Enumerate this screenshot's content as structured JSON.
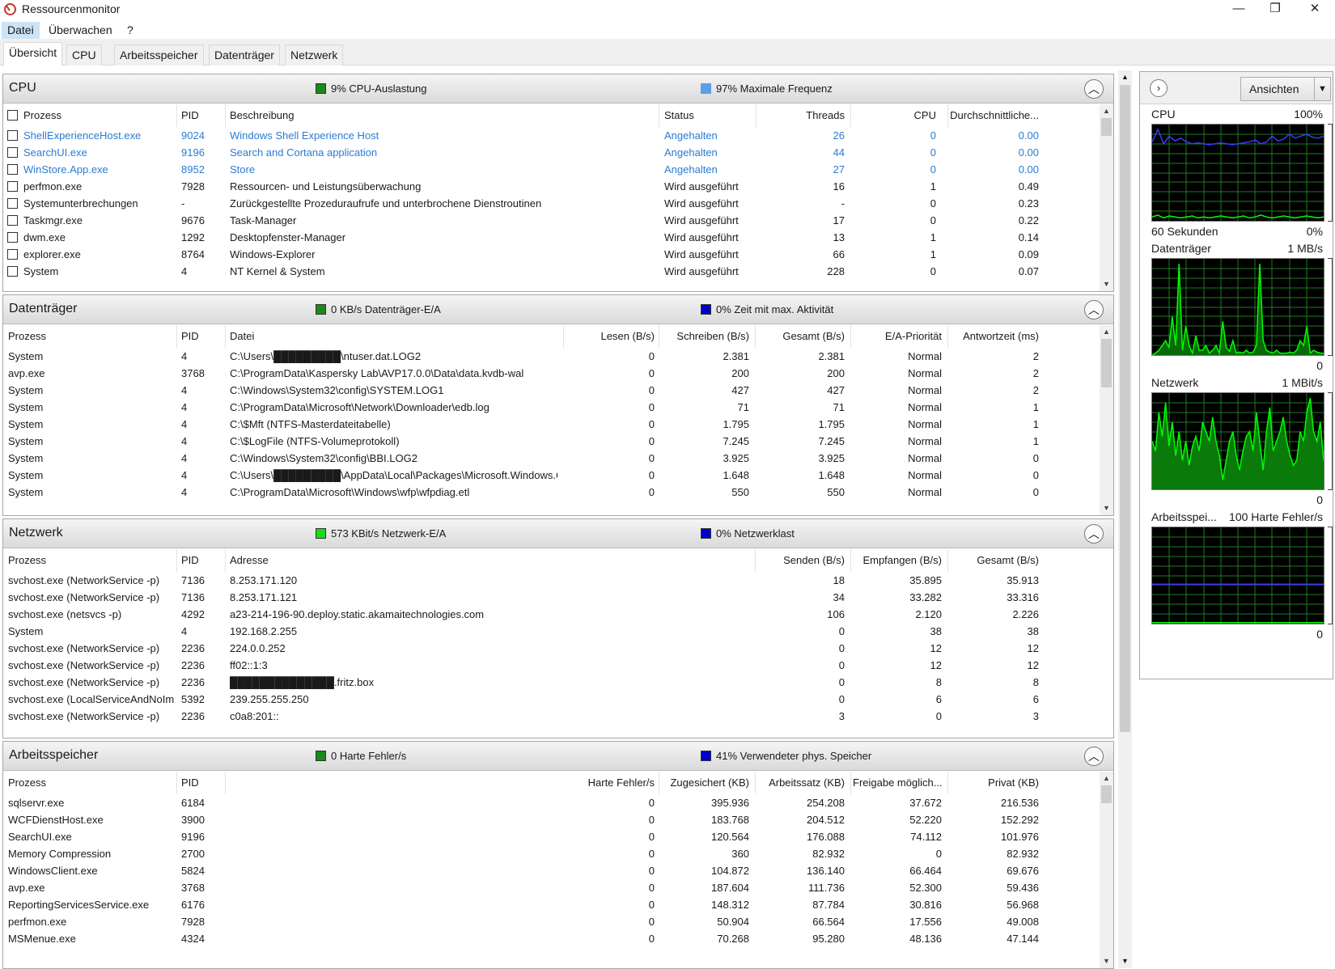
{
  "window": {
    "title": "Ressourcenmonitor",
    "minimize": "—",
    "maximize": "❐",
    "close": "✕"
  },
  "menu": [
    "Datei",
    "Überwachen",
    "?"
  ],
  "tabs": [
    "Übersicht",
    "CPU",
    "Arbeitsspeicher",
    "Datenträger",
    "Netzwerk"
  ],
  "colors": {
    "cpu_indicator": "#1a8a1a",
    "freq_indicator": "#5aa0e8",
    "disk_io": "#1a8a1a",
    "disk_active": "#0000cc",
    "net_io": "#1adb1a",
    "net_load": "#0000cc",
    "mem_fault": "#1a8a1a",
    "mem_used": "#0000cc",
    "link_blue": "#2b7cd3",
    "graph_green": "#00ff00",
    "graph_blue": "#3a3aff"
  },
  "cpu": {
    "title": "CPU",
    "indicator1": "9% CPU-Auslastung",
    "indicator2": "97% Maximale Frequenz",
    "headers": [
      "Prozess",
      "PID",
      "Beschreibung",
      "Status",
      "Threads",
      "CPU",
      "Durchschnittliche..."
    ],
    "rows": [
      {
        "name": "ShellExperienceHost.exe",
        "pid": "9024",
        "desc": "Windows Shell Experience Host",
        "status": "Angehalten",
        "threads": "26",
        "cpu": "0",
        "avg": "0.00",
        "blue": true
      },
      {
        "name": "SearchUI.exe",
        "pid": "9196",
        "desc": "Search and Cortana application",
        "status": "Angehalten",
        "threads": "44",
        "cpu": "0",
        "avg": "0.00",
        "blue": true
      },
      {
        "name": "WinStore.App.exe",
        "pid": "8952",
        "desc": "Store",
        "status": "Angehalten",
        "threads": "27",
        "cpu": "0",
        "avg": "0.00",
        "blue": true
      },
      {
        "name": "perfmon.exe",
        "pid": "7928",
        "desc": "Ressourcen- und Leistungsüberwachung",
        "status": "Wird ausgeführt",
        "threads": "16",
        "cpu": "1",
        "avg": "0.49",
        "blue": false
      },
      {
        "name": "Systemunterbrechungen",
        "pid": "-",
        "desc": "Zurückgestellte Prozeduraufrufe und unterbrochene Dienstroutinen",
        "status": "Wird ausgeführt",
        "threads": "-",
        "cpu": "0",
        "avg": "0.23",
        "blue": false
      },
      {
        "name": "Taskmgr.exe",
        "pid": "9676",
        "desc": "Task-Manager",
        "status": "Wird ausgeführt",
        "threads": "17",
        "cpu": "0",
        "avg": "0.22",
        "blue": false
      },
      {
        "name": "dwm.exe",
        "pid": "1292",
        "desc": "Desktopfenster-Manager",
        "status": "Wird ausgeführt",
        "threads": "13",
        "cpu": "1",
        "avg": "0.14",
        "blue": false
      },
      {
        "name": "explorer.exe",
        "pid": "8764",
        "desc": "Windows-Explorer",
        "status": "Wird ausgeführt",
        "threads": "66",
        "cpu": "1",
        "avg": "0.09",
        "blue": false
      },
      {
        "name": "System",
        "pid": "4",
        "desc": "NT Kernel & System",
        "status": "Wird ausgeführt",
        "threads": "228",
        "cpu": "0",
        "avg": "0.07",
        "blue": false
      }
    ]
  },
  "disk": {
    "title": "Datenträger",
    "indicator1": "0 KB/s Datenträger-E/A",
    "indicator2": "0% Zeit mit max. Aktivität",
    "headers": [
      "Prozess",
      "PID",
      "Datei",
      "Lesen (B/s)",
      "Schreiben (B/s)",
      "Gesamt (B/s)",
      "E/A-Priorität",
      "Antwortzeit (ms)"
    ],
    "rows": [
      {
        "name": "System",
        "pid": "4",
        "file": "C:\\Users\\█████████\\ntuser.dat.LOG2",
        "read": "0",
        "write": "2.381",
        "total": "2.381",
        "prio": "Normal",
        "resp": "2"
      },
      {
        "name": "avp.exe",
        "pid": "3768",
        "file": "C:\\ProgramData\\Kaspersky Lab\\AVP17.0.0\\Data\\data.kvdb-wal",
        "read": "0",
        "write": "200",
        "total": "200",
        "prio": "Normal",
        "resp": "2"
      },
      {
        "name": "System",
        "pid": "4",
        "file": "C:\\Windows\\System32\\config\\SYSTEM.LOG1",
        "read": "0",
        "write": "427",
        "total": "427",
        "prio": "Normal",
        "resp": "2"
      },
      {
        "name": "System",
        "pid": "4",
        "file": "C:\\ProgramData\\Microsoft\\Network\\Downloader\\edb.log",
        "read": "0",
        "write": "71",
        "total": "71",
        "prio": "Normal",
        "resp": "1"
      },
      {
        "name": "System",
        "pid": "4",
        "file": "C:\\$Mft (NTFS-Masterdateitabelle)",
        "read": "0",
        "write": "1.795",
        "total": "1.795",
        "prio": "Normal",
        "resp": "1"
      },
      {
        "name": "System",
        "pid": "4",
        "file": "C:\\$LogFile (NTFS-Volumeprotokoll)",
        "read": "0",
        "write": "7.245",
        "total": "7.245",
        "prio": "Normal",
        "resp": "1"
      },
      {
        "name": "System",
        "pid": "4",
        "file": "C:\\Windows\\System32\\config\\BBI.LOG2",
        "read": "0",
        "write": "3.925",
        "total": "3.925",
        "prio": "Normal",
        "resp": "0"
      },
      {
        "name": "System",
        "pid": "4",
        "file": "C:\\Users\\█████████\\AppData\\Local\\Packages\\Microsoft.Windows.Co...",
        "read": "0",
        "write": "1.648",
        "total": "1.648",
        "prio": "Normal",
        "resp": "0"
      },
      {
        "name": "System",
        "pid": "4",
        "file": "C:\\ProgramData\\Microsoft\\Windows\\wfp\\wfpdiag.etl",
        "read": "0",
        "write": "550",
        "total": "550",
        "prio": "Normal",
        "resp": "0"
      }
    ]
  },
  "network": {
    "title": "Netzwerk",
    "indicator1": "573 KBit/s Netzwerk-E/A",
    "indicator2": "0% Netzwerklast",
    "headers": [
      "Prozess",
      "PID",
      "Adresse",
      "Senden (B/s)",
      "Empfangen (B/s)",
      "Gesamt (B/s)"
    ],
    "rows": [
      {
        "name": "svchost.exe (NetworkService -p)",
        "pid": "7136",
        "addr": "8.253.171.120",
        "send": "18",
        "recv": "35.895",
        "total": "35.913"
      },
      {
        "name": "svchost.exe (NetworkService -p)",
        "pid": "7136",
        "addr": "8.253.171.121",
        "send": "34",
        "recv": "33.282",
        "total": "33.316"
      },
      {
        "name": "svchost.exe (netsvcs -p)",
        "pid": "4292",
        "addr": "a23-214-196-90.deploy.static.akamaitechnologies.com",
        "send": "106",
        "recv": "2.120",
        "total": "2.226"
      },
      {
        "name": "System",
        "pid": "4",
        "addr": "192.168.2.255",
        "send": "0",
        "recv": "38",
        "total": "38"
      },
      {
        "name": "svchost.exe (NetworkService -p)",
        "pid": "2236",
        "addr": "224.0.0.252",
        "send": "0",
        "recv": "12",
        "total": "12"
      },
      {
        "name": "svchost.exe (NetworkService -p)",
        "pid": "2236",
        "addr": "ff02::1:3",
        "send": "0",
        "recv": "12",
        "total": "12"
      },
      {
        "name": "svchost.exe (NetworkService -p)",
        "pid": "2236",
        "addr": "██████████████.fritz.box",
        "send": "0",
        "recv": "8",
        "total": "8"
      },
      {
        "name": "svchost.exe (LocalServiceAndNoIm...",
        "pid": "5392",
        "addr": "239.255.255.250",
        "send": "0",
        "recv": "6",
        "total": "6"
      },
      {
        "name": "svchost.exe (NetworkService -p)",
        "pid": "2236",
        "addr": "c0a8:201::",
        "send": "3",
        "recv": "0",
        "total": "3"
      }
    ]
  },
  "memory": {
    "title": "Arbeitsspeicher",
    "indicator1": "0 Harte Fehler/s",
    "indicator2": "41% Verwendeter phys. Speicher",
    "headers": [
      "Prozess",
      "PID",
      "Harte Fehler/s",
      "Zugesichert (KB)",
      "Arbeitssatz (KB)",
      "Freigabe möglich...",
      "Privat (KB)"
    ],
    "rows": [
      {
        "name": "sqlservr.exe",
        "pid": "6184",
        "faults": "0",
        "commit": "395.936",
        "ws": "254.208",
        "share": "37.672",
        "priv": "216.536"
      },
      {
        "name": "WCFDienstHost.exe",
        "pid": "3900",
        "faults": "0",
        "commit": "183.768",
        "ws": "204.512",
        "share": "52.220",
        "priv": "152.292"
      },
      {
        "name": "SearchUI.exe",
        "pid": "9196",
        "faults": "0",
        "commit": "120.564",
        "ws": "176.088",
        "share": "74.112",
        "priv": "101.976"
      },
      {
        "name": "Memory Compression",
        "pid": "2700",
        "faults": "0",
        "commit": "360",
        "ws": "82.932",
        "share": "0",
        "priv": "82.932"
      },
      {
        "name": "WindowsClient.exe",
        "pid": "5824",
        "faults": "0",
        "commit": "104.872",
        "ws": "136.140",
        "share": "66.464",
        "priv": "69.676"
      },
      {
        "name": "avp.exe",
        "pid": "3768",
        "faults": "0",
        "commit": "187.604",
        "ws": "111.736",
        "share": "52.300",
        "priv": "59.436"
      },
      {
        "name": "ReportingServicesService.exe",
        "pid": "6176",
        "faults": "0",
        "commit": "148.312",
        "ws": "87.784",
        "share": "30.816",
        "priv": "56.968"
      },
      {
        "name": "perfmon.exe",
        "pid": "7928",
        "faults": "0",
        "commit": "50.904",
        "ws": "66.564",
        "share": "17.556",
        "priv": "49.008"
      },
      {
        "name": "MSMenue.exe",
        "pid": "4324",
        "faults": "0",
        "commit": "70.268",
        "ws": "95.280",
        "share": "48.136",
        "priv": "47.144"
      }
    ]
  },
  "sidebar": {
    "views_button": "Ansichten",
    "graphs": [
      {
        "label": "CPU",
        "max": "100%",
        "bottom_left": "60 Sekunden",
        "bottom_right": "0%"
      },
      {
        "label": "Datenträger",
        "max": "1 MB/s",
        "bottom_left": "",
        "bottom_right": "0"
      },
      {
        "label": "Netzwerk",
        "max": "1 MBit/s",
        "bottom_left": "",
        "bottom_right": "0"
      },
      {
        "label": "Arbeitsspei...",
        "max": "100 Harte Fehler/s",
        "bottom_left": "",
        "bottom_right": "0"
      }
    ]
  }
}
